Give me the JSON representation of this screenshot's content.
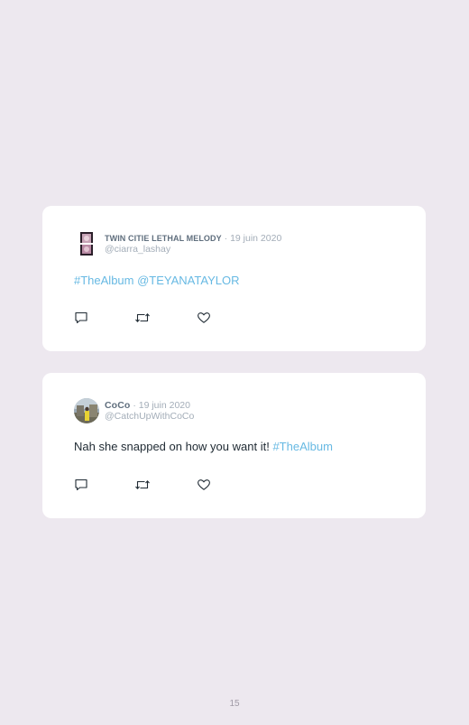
{
  "tweets": [
    {
      "author": "TWIN CITIE LETHAL MELODY",
      "separator": "·",
      "date": "19 juin 2020",
      "handle": "@ciarra_lashay",
      "text_before": "",
      "hashtag": "#TheAlbum",
      "mention": "@TEYANATAYLOR",
      "avatar_icon": "profile-photo-icon"
    },
    {
      "author": "CoCo",
      "separator": "·",
      "date": "19 juin 2020",
      "handle": "@CatchUpWithCoCo",
      "text_before": "Nah she snapped on how you want it!",
      "hashtag": "#TheAlbum",
      "mention": "",
      "avatar_icon": "profile-photo-icon"
    }
  ],
  "actions": {
    "reply_icon": "reply-icon",
    "retweet_icon": "retweet-icon",
    "like_icon": "heart-icon"
  },
  "page_number": "15",
  "colors": {
    "background": "#ede8ef",
    "card": "#ffffff",
    "link": "#67b9e3",
    "meta": "#a3adb8"
  }
}
